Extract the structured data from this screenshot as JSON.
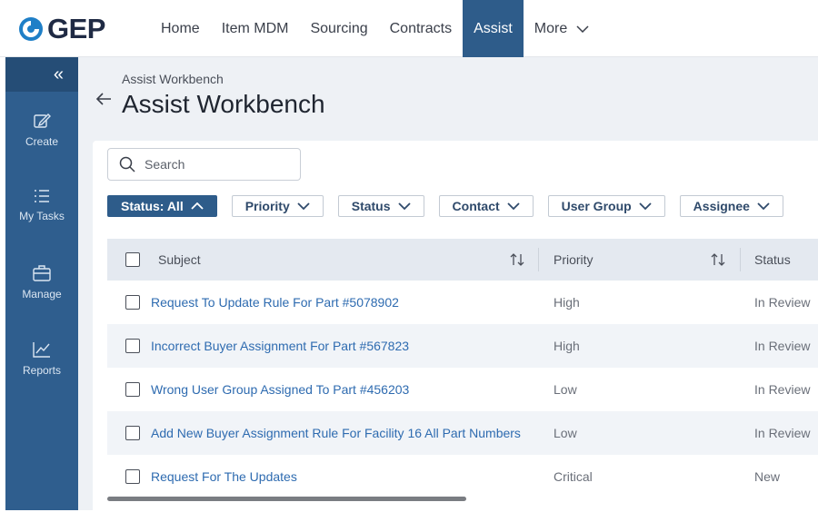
{
  "app": {
    "logo_text": "GEP"
  },
  "nav": {
    "items": [
      {
        "label": "Home"
      },
      {
        "label": "Item MDM"
      },
      {
        "label": "Sourcing"
      },
      {
        "label": "Contracts"
      },
      {
        "label": "Assist"
      },
      {
        "label": "More"
      }
    ],
    "active": "Assist"
  },
  "sidebar": {
    "items": [
      {
        "label": "Create",
        "icon": "edit-icon"
      },
      {
        "label": "My Tasks",
        "icon": "list-icon"
      },
      {
        "label": "Manage",
        "icon": "briefcase-icon"
      },
      {
        "label": "Reports",
        "icon": "chart-line-icon"
      }
    ]
  },
  "page": {
    "breadcrumb": "Assist Workbench",
    "title": "Assist Workbench"
  },
  "search": {
    "placeholder": "Search",
    "value": ""
  },
  "filters": [
    {
      "label": "Status: All",
      "active": true
    },
    {
      "label": "Priority"
    },
    {
      "label": "Status"
    },
    {
      "label": "Contact"
    },
    {
      "label": "User Group"
    },
    {
      "label": "Assignee"
    }
  ],
  "table": {
    "columns": [
      "Subject",
      "Priority",
      "Status"
    ],
    "rows": [
      {
        "subject": "Request To Update Rule For Part #5078902",
        "priority": "High",
        "status": "In Review"
      },
      {
        "subject": "Incorrect Buyer Assignment For Part #567823",
        "priority": "High",
        "status": "In Review"
      },
      {
        "subject": "Wrong User Group Assigned To Part #456203",
        "priority": "Low",
        "status": "In Review"
      },
      {
        "subject": "Add New Buyer Assignment Rule For Facility 16 All Part Numbers",
        "priority": "Low",
        "status": "In Review"
      },
      {
        "subject": "Request For The Updates",
        "priority": "Critical",
        "status": "New"
      }
    ]
  },
  "colors": {
    "accent": "#2e5c8a",
    "sidebar": "#2f5e8e",
    "link": "#2e6bb0",
    "logo_blue": "#1f7fc7"
  }
}
